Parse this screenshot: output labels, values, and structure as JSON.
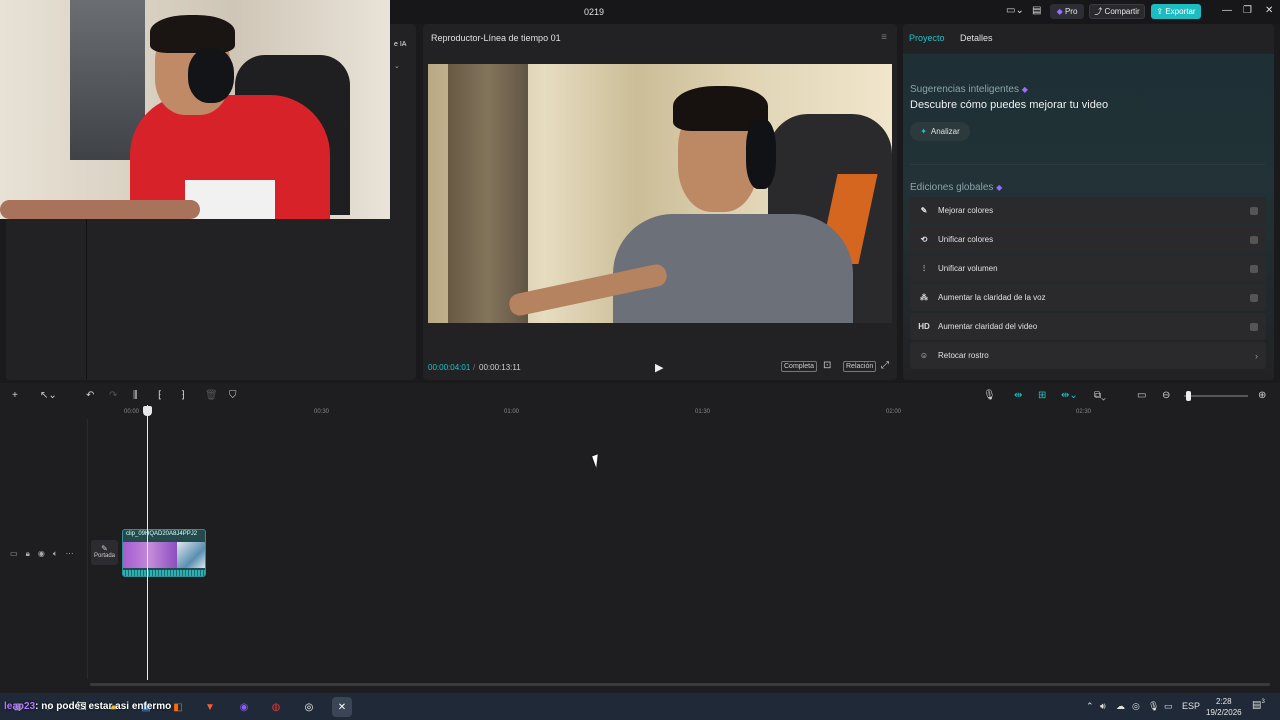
{
  "window": {
    "title": "0219",
    "pro_label": "Pro",
    "share_label": "Compartir",
    "export_label": "Exportar",
    "minimize": "—",
    "maximize": "❐",
    "close": "✕"
  },
  "left_panel": {
    "ia_label": "e IA"
  },
  "player": {
    "title": "Reproductor-Línea de tiempo 01",
    "time_current": "00:00:04:01",
    "time_separator": "/",
    "time_total": "00:00:13:11",
    "complete_label": "Completa",
    "ratio_label": "Relación"
  },
  "right_panel": {
    "tabs": [
      {
        "label": "Proyecto",
        "active": true
      },
      {
        "label": "Detalles",
        "active": false
      }
    ],
    "suggestions_title": "Sugerencias inteligentes",
    "suggestions_subtitle": "Descubre cómo puedes mejorar tu video",
    "analyze_label": "Analizar",
    "global_edits_title": "Ediciones globales",
    "options": [
      {
        "icon": "✎",
        "label": "Mejorar colores",
        "control": "toggle"
      },
      {
        "icon": "⟲",
        "label": "Unificar colores",
        "control": "toggle"
      },
      {
        "icon": "⫶",
        "label": "Unificar volumen",
        "control": "toggle"
      },
      {
        "icon": "⁂",
        "label": "Aumentar la claridad de la voz",
        "control": "toggle"
      },
      {
        "icon": "HD",
        "label": "Aumentar claridad del video",
        "control": "toggle"
      },
      {
        "icon": "☺",
        "label": "Retocar rostro",
        "control": "chevron"
      }
    ]
  },
  "timeline": {
    "ruler": [
      "00:00",
      "00:30",
      "01:00",
      "01:30",
      "02:00",
      "02:30"
    ],
    "cover_label": "Portada",
    "clip_name": "clip_09HQAD20A8J4PPJ2",
    "clip_position_seconds": 0,
    "clip_duration_seconds": 13.44,
    "playhead_seconds": 4.03
  },
  "taskbar": {
    "caption_nick": "leap23",
    "caption_text": ": no podés estar asi enfermo",
    "language": "ESP",
    "time": "2:28",
    "date": "19/2/2026",
    "notifications": "3"
  },
  "colors": {
    "accent": "#1ec1c6",
    "gem": "#9b6cff"
  }
}
